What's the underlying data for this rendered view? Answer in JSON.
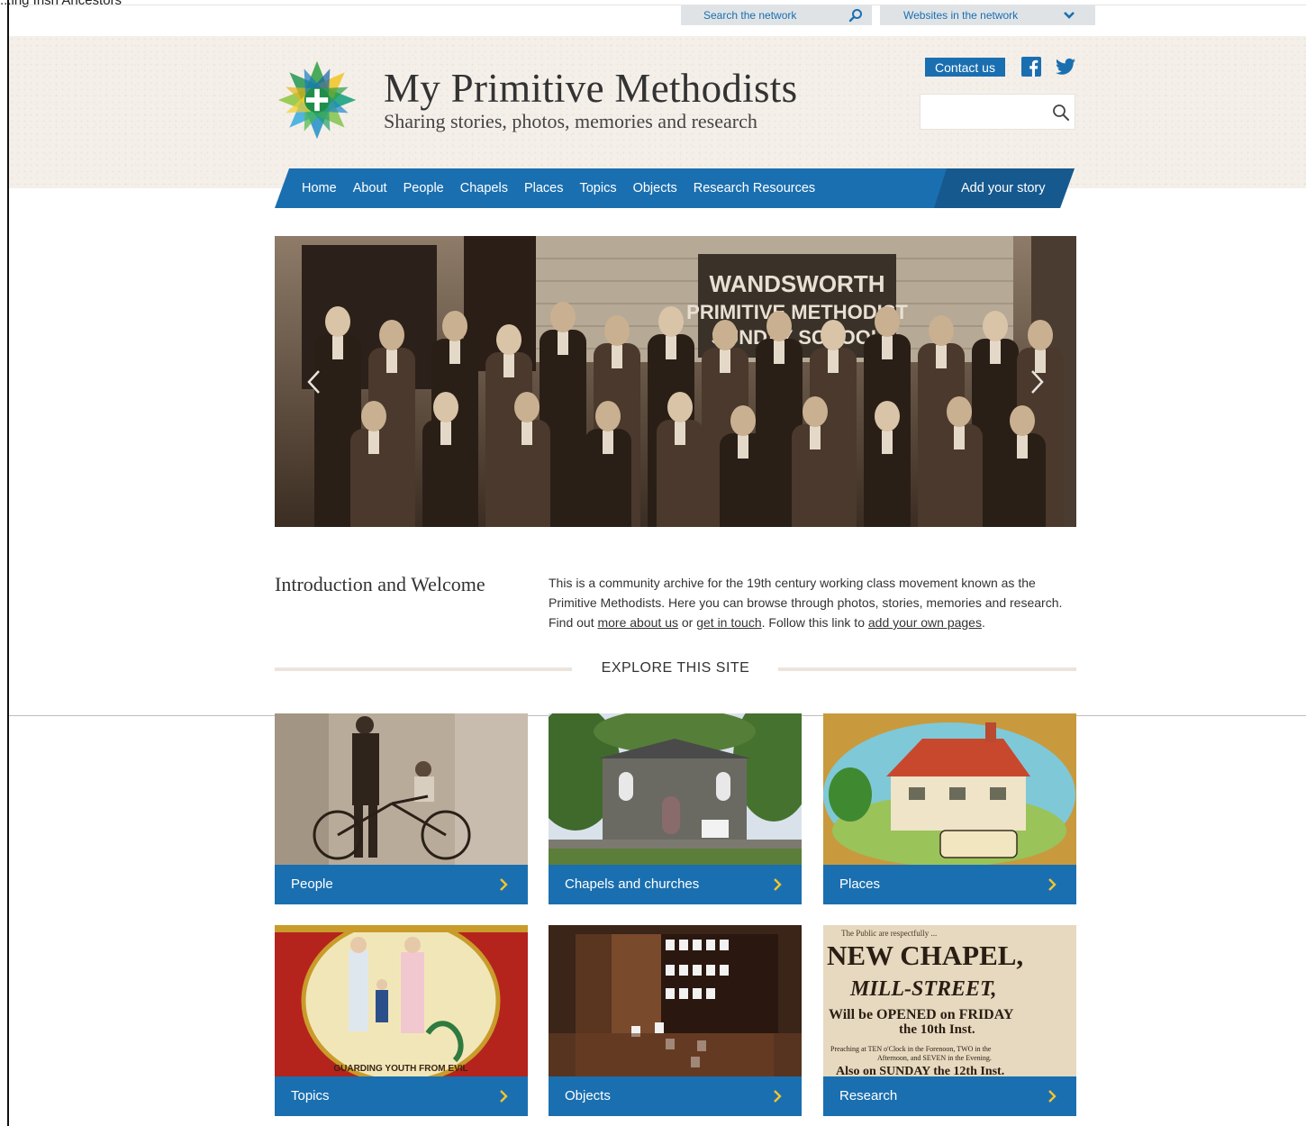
{
  "window": {
    "title": "...ing Irish Ancestors"
  },
  "network": {
    "search_label": "Search the network",
    "sites_label": "Websites in the network"
  },
  "site": {
    "title": "My Primitive Methodists",
    "tagline": "Sharing stories, photos, memories and research",
    "contact_label": "Contact us",
    "search_placeholder": ""
  },
  "nav": {
    "items": [
      "Home",
      "About",
      "People",
      "Chapels",
      "Places",
      "Topics",
      "Objects",
      "Research Resources"
    ],
    "add_story": "Add your story"
  },
  "hero": {
    "banner_line1": "WANDSWORTH",
    "banner_line2": "PRIMITIVE METHODIST",
    "banner_line3": "SUNDAY SCHOOL"
  },
  "intro": {
    "heading": "Introduction and Welcome",
    "text_part1": "This is a community archive for the 19th century working class movement known as the Primitive Methodists. Here you can browse through photos, stories, memories and research.  Find out ",
    "link_about": "more about us",
    "text_or": " or ",
    "link_contact": "get in touch",
    "text_follow": ". Follow this link to ",
    "link_pages": "add your own pages",
    "text_end": "."
  },
  "explore": {
    "heading": "EXPLORE THIS SITE"
  },
  "cards": [
    {
      "label": "People"
    },
    {
      "label": "Chapels and churches"
    },
    {
      "label": "Places"
    },
    {
      "label": "Topics",
      "banner_text": "GUARDING YOUTH FROM EVIL"
    },
    {
      "label": "Objects"
    },
    {
      "label": "Research",
      "poster_line0": "The Public are respectfully ...",
      "poster_line1": "NEW CHAPEL,",
      "poster_line2": "MILL-STREET,",
      "poster_line3": "Will be OPENED on FRIDAY",
      "poster_line4": "the 10th Inst.",
      "poster_line5": "Preaching at TEN o'Clock in the Forenoon, TWO in the",
      "poster_line6": "Afternoon, and SEVEN in the Evening.",
      "poster_line7": "Also on SUNDAY the 12th Inst."
    }
  ],
  "colors": {
    "brand_blue": "#1a6fb0",
    "nav_dark": "#16598f",
    "header_bg": "#f4efe9",
    "network_bar": "#dfe3e6"
  }
}
